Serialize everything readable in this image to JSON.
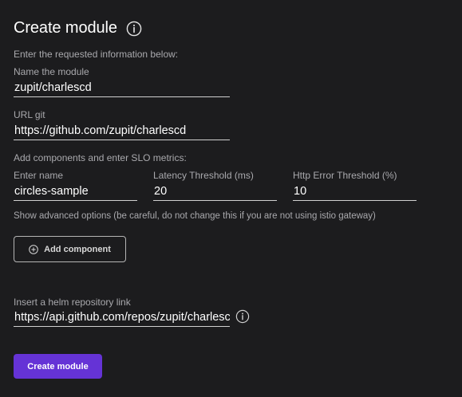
{
  "header": {
    "title": "Create module",
    "info_icon": "info-circle-icon"
  },
  "intro_text": "Enter the requested information below:",
  "module_name": {
    "label": "Name the module",
    "value": "zupit/charlescd"
  },
  "url_git": {
    "label": "URL git",
    "value": "https://github.com/zupit/charlescd"
  },
  "components": {
    "heading": "Add components and enter SLO metrics:",
    "name_label": "Enter name",
    "name_value": "circles-sample",
    "latency_label": "Latency Threshold (ms)",
    "latency_value": "20",
    "error_label": "Http Error Threshold (%)",
    "error_value": "10",
    "advanced_options": "Show advanced options (be careful, do not change this if you are not using istio gateway)",
    "add_button_label": "Add component",
    "add_button_icon": "plus-circle-icon"
  },
  "helm": {
    "label": "Insert a helm repository link",
    "value": "https://api.github.com/repos/zupit/charlescd",
    "info_icon": "info-circle-icon"
  },
  "submit": {
    "label": "Create module",
    "color": "#6533d6"
  },
  "colors": {
    "background": "#1c1c1e",
    "label": "#a9a9ad",
    "underline": "#d0d0d0",
    "primary": "#6533d6"
  }
}
